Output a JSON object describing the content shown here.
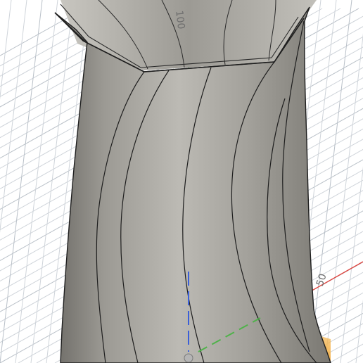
{
  "viewport": {
    "background": "#ffffff",
    "grid_color": "#cfd4da",
    "grid_major_color": "#b9c0c8",
    "model_face_color": "#a7a59f",
    "model_edge_color": "#1e1e1e",
    "inner_wall_color": "#8e8c86"
  },
  "axes": {
    "y_axis": {
      "label": "100",
      "color": "#4fb24a"
    },
    "x_axis": {
      "label": "50",
      "color": "#e0403a"
    },
    "z_axis_color": "#3b5fd8"
  },
  "origin_gizmo": {
    "plane_front_color": "#f3b24a",
    "plane_side_color": "#9fb3e0",
    "origin_point_color": "#b5b5b5"
  },
  "model": {
    "type": "twisted-hexagonal-vase",
    "icon": "solid-body-icon"
  }
}
